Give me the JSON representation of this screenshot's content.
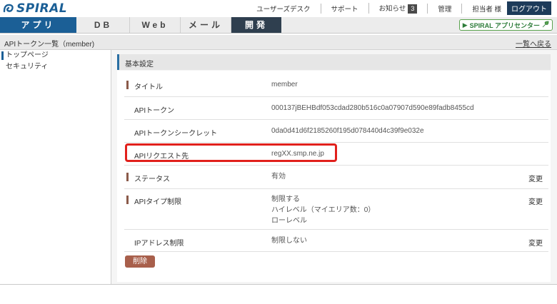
{
  "brand": {
    "name": "SPIRAL",
    "accent": "#1b5f96"
  },
  "topbar": {
    "links": [
      "ユーザーズデスク",
      "サポート",
      "お知らせ",
      "管理",
      "担当者 様"
    ],
    "notice_count": "3",
    "logout_label": "ログアウト"
  },
  "nav": {
    "tabs": [
      "アプリ",
      "DB",
      "Web",
      "メール",
      "開発"
    ],
    "active_tab": "開発",
    "app_center_label": "SPIRAL アプリセンター"
  },
  "subheader": {
    "title": "APIトークン一覧（member)",
    "back_label": "一覧へ戻る"
  },
  "sidebar": {
    "items": [
      "トップページ",
      "セキュリティ"
    ]
  },
  "section": {
    "title": "基本設定"
  },
  "details": {
    "rows": [
      {
        "label": "タイトル",
        "value": "member",
        "change": ""
      },
      {
        "label": "APIトークン",
        "value": "000137jBEHBdf053cdad280b516c0a07907d590e89fadb8455cd",
        "change": ""
      },
      {
        "label": "APIトークンシークレット",
        "value": "0da0d41d6f2185260f195d078440d4c39f9e032e",
        "change": ""
      },
      {
        "label": "APIリクエスト先",
        "value": "regXX.smp.ne.jp",
        "change": ""
      },
      {
        "label": "ステータス",
        "value": "有効",
        "change": "変更"
      },
      {
        "label": "APIタイプ制限",
        "value": "制限する",
        "value_line2": "ハイレベル（マイエリア数：0）",
        "value_line3": "ローレベル",
        "change": "変更"
      },
      {
        "label": "IPアドレス制限",
        "value": "制限しない",
        "change": "変更"
      }
    ]
  },
  "delete_label": "削除",
  "colors": {
    "highlight_border": "#e1201c",
    "marker": "#8b5a4a",
    "delete_button": "#a85f4b",
    "active_dev_tab": "#2f3f4f"
  }
}
